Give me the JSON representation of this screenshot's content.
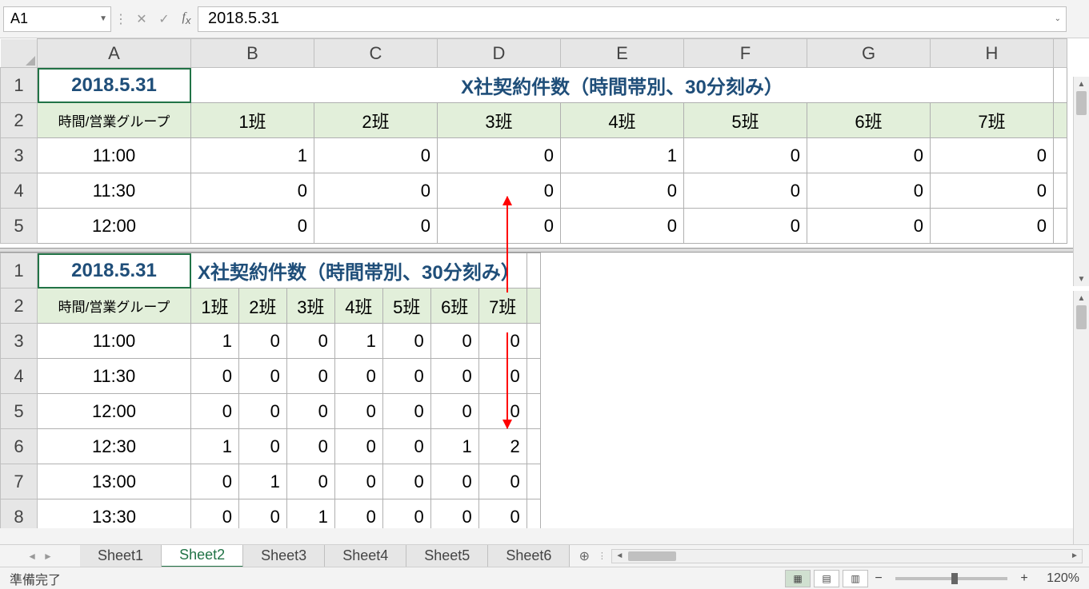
{
  "formula_bar": {
    "name_box": "A1",
    "formula_value": "2018.5.31"
  },
  "columns": [
    "A",
    "B",
    "C",
    "D",
    "E",
    "F",
    "G",
    "H"
  ],
  "pane_top": {
    "row_numbers": [
      "1",
      "2",
      "3",
      "4",
      "5"
    ],
    "title_date": "2018.5.31",
    "title_main": "X社契約件数（時間帯別、30分刻み）",
    "headers": [
      "時間/営業グループ",
      "1班",
      "2班",
      "3班",
      "4班",
      "5班",
      "6班",
      "7班"
    ],
    "rows": [
      {
        "time": "11:00",
        "vals": [
          "1",
          "0",
          "0",
          "1",
          "0",
          "0",
          "0"
        ]
      },
      {
        "time": "11:30",
        "vals": [
          "0",
          "0",
          "0",
          "0",
          "0",
          "0",
          "0"
        ]
      },
      {
        "time": "12:00",
        "vals": [
          "0",
          "0",
          "0",
          "0",
          "0",
          "0",
          "0"
        ]
      }
    ]
  },
  "pane_bottom": {
    "row_numbers": [
      "1",
      "2",
      "3",
      "4",
      "5",
      "6",
      "7",
      "8"
    ],
    "title_date": "2018.5.31",
    "title_main": "X社契約件数（時間帯別、30分刻み）",
    "headers": [
      "時間/営業グループ",
      "1班",
      "2班",
      "3班",
      "4班",
      "5班",
      "6班",
      "7班"
    ],
    "rows": [
      {
        "time": "11:00",
        "vals": [
          "1",
          "0",
          "0",
          "1",
          "0",
          "0",
          "0"
        ]
      },
      {
        "time": "11:30",
        "vals": [
          "0",
          "0",
          "0",
          "0",
          "0",
          "0",
          "0"
        ]
      },
      {
        "time": "12:00",
        "vals": [
          "0",
          "0",
          "0",
          "0",
          "0",
          "0",
          "0"
        ]
      },
      {
        "time": "12:30",
        "vals": [
          "1",
          "0",
          "0",
          "0",
          "0",
          "1",
          "2"
        ]
      },
      {
        "time": "13:00",
        "vals": [
          "0",
          "1",
          "0",
          "0",
          "0",
          "0",
          "0"
        ]
      },
      {
        "time": "13:30",
        "vals": [
          "0",
          "0",
          "1",
          "0",
          "0",
          "0",
          "0"
        ]
      }
    ]
  },
  "sheet_tabs": [
    "Sheet1",
    "Sheet2",
    "Sheet3",
    "Sheet4",
    "Sheet5",
    "Sheet6"
  ],
  "active_tab": "Sheet2",
  "status": {
    "left": "準備完了",
    "zoom": "120%"
  }
}
